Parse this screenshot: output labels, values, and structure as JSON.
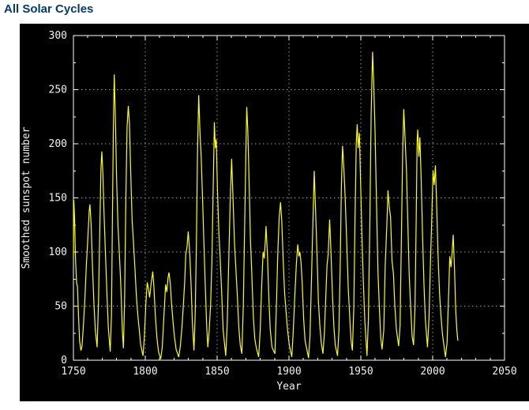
{
  "header": {
    "title": "All Solar Cycles"
  },
  "chart_data": {
    "type": "line",
    "title": "All Solar Cycles",
    "xlabel": "Year",
    "ylabel": "Smoothed sunspot number",
    "xlim": [
      1750,
      2050
    ],
    "ylim": [
      0,
      300
    ],
    "x_major_ticks": [
      1750,
      1800,
      1850,
      1900,
      1950,
      2000,
      2050
    ],
    "x_minor_step": 10,
    "y_major_ticks": [
      0,
      50,
      100,
      150,
      200,
      250,
      300
    ],
    "y_minor_step": 25,
    "grid": "dotted",
    "legend": "none",
    "colors": {
      "line": "#ffff00",
      "plot_background": "#000000",
      "page_background": "#ffffff",
      "frame": "#ffffff",
      "grid": "#9a9a9a",
      "tick_text": "#f2f2f2",
      "title_text": "#003b76"
    },
    "series": [
      {
        "name": "Smoothed sunspot number",
        "points": [
          [
            1750.0,
            95
          ],
          [
            1750.3,
            148
          ],
          [
            1750.8,
            130
          ],
          [
            1751.5,
            92
          ],
          [
            1752.2,
            72
          ],
          [
            1752.8,
            68
          ],
          [
            1753.5,
            42
          ],
          [
            1754.3,
            18
          ],
          [
            1755.2,
            9
          ],
          [
            1756.0,
            13
          ],
          [
            1757.0,
            33
          ],
          [
            1758.0,
            58
          ],
          [
            1759.0,
            88
          ],
          [
            1760.0,
            112
          ],
          [
            1761.0,
            138
          ],
          [
            1761.5,
            144
          ],
          [
            1762.3,
            126
          ],
          [
            1763.2,
            90
          ],
          [
            1764.2,
            55
          ],
          [
            1765.2,
            28
          ],
          [
            1766.5,
            12
          ],
          [
            1767.5,
            55
          ],
          [
            1768.4,
            125
          ],
          [
            1769.2,
            178
          ],
          [
            1769.8,
            193
          ],
          [
            1770.5,
            172
          ],
          [
            1771.3,
            135
          ],
          [
            1772.3,
            98
          ],
          [
            1773.3,
            62
          ],
          [
            1774.3,
            30
          ],
          [
            1775.6,
            8
          ],
          [
            1776.5,
            42
          ],
          [
            1777.2,
            140
          ],
          [
            1777.8,
            215
          ],
          [
            1778.4,
            264
          ],
          [
            1779.2,
            225
          ],
          [
            1780.0,
            170
          ],
          [
            1781.0,
            125
          ],
          [
            1782.0,
            98
          ],
          [
            1783.0,
            68
          ],
          [
            1784.0,
            28
          ],
          [
            1784.8,
            11
          ],
          [
            1785.6,
            55
          ],
          [
            1786.5,
            148
          ],
          [
            1787.3,
            215
          ],
          [
            1788.2,
            235
          ],
          [
            1789.0,
            218
          ],
          [
            1789.8,
            178
          ],
          [
            1790.8,
            130
          ],
          [
            1791.8,
            108
          ],
          [
            1792.8,
            85
          ],
          [
            1793.8,
            60
          ],
          [
            1794.8,
            42
          ],
          [
            1795.8,
            28
          ],
          [
            1796.8,
            14
          ],
          [
            1798.4,
            4
          ],
          [
            1799.4,
            22
          ],
          [
            1800.4,
            52
          ],
          [
            1801.4,
            72
          ],
          [
            1802.2,
            66
          ],
          [
            1803.0,
            58
          ],
          [
            1804.0,
            70
          ],
          [
            1805.2,
            82
          ],
          [
            1806.0,
            68
          ],
          [
            1807.0,
            42
          ],
          [
            1808.0,
            22
          ],
          [
            1809.2,
            8
          ],
          [
            1810.7,
            1
          ],
          [
            1811.8,
            12
          ],
          [
            1813.0,
            42
          ],
          [
            1814.2,
            70
          ],
          [
            1815.0,
            63
          ],
          [
            1815.8,
            76
          ],
          [
            1816.5,
            81
          ],
          [
            1817.4,
            71
          ],
          [
            1818.3,
            52
          ],
          [
            1819.3,
            36
          ],
          [
            1820.3,
            22
          ],
          [
            1821.5,
            10
          ],
          [
            1823.3,
            3
          ],
          [
            1824.4,
            13
          ],
          [
            1825.4,
            28
          ],
          [
            1826.4,
            48
          ],
          [
            1827.4,
            72
          ],
          [
            1828.2,
            98
          ],
          [
            1829.0,
            104
          ],
          [
            1829.9,
            119
          ],
          [
            1830.8,
            102
          ],
          [
            1831.8,
            72
          ],
          [
            1832.8,
            34
          ],
          [
            1833.9,
            9
          ],
          [
            1834.8,
            45
          ],
          [
            1835.6,
            110
          ],
          [
            1836.4,
            195
          ],
          [
            1837.2,
            245
          ],
          [
            1838.0,
            212
          ],
          [
            1838.9,
            188
          ],
          [
            1839.9,
            148
          ],
          [
            1840.9,
            105
          ],
          [
            1841.9,
            62
          ],
          [
            1842.8,
            30
          ],
          [
            1843.5,
            12
          ],
          [
            1844.5,
            28
          ],
          [
            1845.5,
            52
          ],
          [
            1846.4,
            92
          ],
          [
            1847.3,
            162
          ],
          [
            1848.1,
            220
          ],
          [
            1848.8,
            196
          ],
          [
            1849.4,
            204
          ],
          [
            1850.2,
            158
          ],
          [
            1851.2,
            118
          ],
          [
            1852.2,
            92
          ],
          [
            1853.2,
            62
          ],
          [
            1854.2,
            28
          ],
          [
            1856.0,
            4
          ],
          [
            1857.0,
            32
          ],
          [
            1858.0,
            88
          ],
          [
            1859.1,
            148
          ],
          [
            1860.1,
            186
          ],
          [
            1861.1,
            148
          ],
          [
            1862.1,
            108
          ],
          [
            1863.1,
            84
          ],
          [
            1864.1,
            58
          ],
          [
            1865.1,
            30
          ],
          [
            1866.1,
            14
          ],
          [
            1867.2,
            6
          ],
          [
            1868.2,
            48
          ],
          [
            1869.0,
            112
          ],
          [
            1869.9,
            182
          ],
          [
            1870.6,
            234
          ],
          [
            1871.4,
            212
          ],
          [
            1872.2,
            168
          ],
          [
            1873.2,
            112
          ],
          [
            1874.2,
            78
          ],
          [
            1875.2,
            40
          ],
          [
            1876.2,
            20
          ],
          [
            1877.2,
            12
          ],
          [
            1878.9,
            3
          ],
          [
            1880.0,
            28
          ],
          [
            1881.0,
            68
          ],
          [
            1882.0,
            100
          ],
          [
            1882.8,
            94
          ],
          [
            1883.6,
            112
          ],
          [
            1884.0,
            124
          ],
          [
            1885.0,
            98
          ],
          [
            1886.0,
            58
          ],
          [
            1887.0,
            28
          ],
          [
            1888.2,
            12
          ],
          [
            1890.2,
            6
          ],
          [
            1891.2,
            48
          ],
          [
            1892.2,
            98
          ],
          [
            1893.2,
            132
          ],
          [
            1894.1,
            146
          ],
          [
            1895.0,
            128
          ],
          [
            1896.0,
            92
          ],
          [
            1897.0,
            62
          ],
          [
            1898.0,
            44
          ],
          [
            1899.0,
            28
          ],
          [
            1900.2,
            14
          ],
          [
            1902.0,
            3
          ],
          [
            1903.0,
            28
          ],
          [
            1904.0,
            58
          ],
          [
            1905.1,
            88
          ],
          [
            1906.1,
            107
          ],
          [
            1906.9,
            96
          ],
          [
            1907.6,
            100
          ],
          [
            1908.4,
            90
          ],
          [
            1909.2,
            72
          ],
          [
            1910.2,
            38
          ],
          [
            1911.2,
            18
          ],
          [
            1913.6,
            2
          ],
          [
            1914.6,
            22
          ],
          [
            1915.6,
            72
          ],
          [
            1916.6,
            124
          ],
          [
            1917.6,
            175
          ],
          [
            1918.5,
            138
          ],
          [
            1919.5,
            98
          ],
          [
            1920.5,
            54
          ],
          [
            1921.5,
            32
          ],
          [
            1922.5,
            16
          ],
          [
            1923.6,
            6
          ],
          [
            1924.6,
            24
          ],
          [
            1925.6,
            58
          ],
          [
            1926.5,
            88
          ],
          [
            1927.3,
            98
          ],
          [
            1928.3,
            130
          ],
          [
            1929.2,
            102
          ],
          [
            1930.2,
            62
          ],
          [
            1931.2,
            32
          ],
          [
            1932.2,
            14
          ],
          [
            1933.8,
            4
          ],
          [
            1934.8,
            28
          ],
          [
            1935.7,
            92
          ],
          [
            1936.5,
            162
          ],
          [
            1937.3,
            198
          ],
          [
            1938.2,
            178
          ],
          [
            1939.2,
            148
          ],
          [
            1940.2,
            108
          ],
          [
            1941.2,
            68
          ],
          [
            1942.2,
            42
          ],
          [
            1943.2,
            18
          ],
          [
            1944.1,
            9
          ],
          [
            1945.1,
            48
          ],
          [
            1946.0,
            132
          ],
          [
            1946.8,
            200
          ],
          [
            1947.5,
            218
          ],
          [
            1948.2,
            196
          ],
          [
            1949.0,
            210
          ],
          [
            1949.9,
            162
          ],
          [
            1950.8,
            112
          ],
          [
            1951.8,
            70
          ],
          [
            1952.8,
            36
          ],
          [
            1954.3,
            4
          ],
          [
            1955.3,
            38
          ],
          [
            1956.3,
            132
          ],
          [
            1957.2,
            228
          ],
          [
            1958.2,
            285
          ],
          [
            1959.0,
            255
          ],
          [
            1959.9,
            212
          ],
          [
            1960.9,
            148
          ],
          [
            1961.9,
            82
          ],
          [
            1962.9,
            48
          ],
          [
            1963.9,
            20
          ],
          [
            1964.8,
            10
          ],
          [
            1966.0,
            28
          ],
          [
            1967.0,
            88
          ],
          [
            1968.0,
            122
          ],
          [
            1968.9,
            157
          ],
          [
            1969.8,
            142
          ],
          [
            1970.7,
            132
          ],
          [
            1971.7,
            92
          ],
          [
            1972.7,
            80
          ],
          [
            1973.7,
            50
          ],
          [
            1974.8,
            28
          ],
          [
            1976.3,
            13
          ],
          [
            1977.3,
            32
          ],
          [
            1978.2,
            108
          ],
          [
            1979.1,
            192
          ],
          [
            1979.9,
            232
          ],
          [
            1980.8,
            204
          ],
          [
            1981.7,
            178
          ],
          [
            1982.7,
            128
          ],
          [
            1983.7,
            78
          ],
          [
            1984.7,
            48
          ],
          [
            1985.7,
            22
          ],
          [
            1986.7,
            14
          ],
          [
            1987.7,
            48
          ],
          [
            1988.5,
            128
          ],
          [
            1989.2,
            202
          ],
          [
            1989.6,
            213
          ],
          [
            1990.4,
            188
          ],
          [
            1991.1,
            206
          ],
          [
            1992.0,
            168
          ],
          [
            1992.9,
            118
          ],
          [
            1993.9,
            72
          ],
          [
            1994.9,
            38
          ],
          [
            1996.4,
            12
          ],
          [
            1997.4,
            38
          ],
          [
            1998.4,
            88
          ],
          [
            1999.4,
            132
          ],
          [
            2000.3,
            175
          ],
          [
            2001.1,
            162
          ],
          [
            2001.9,
            180
          ],
          [
            2002.8,
            142
          ],
          [
            2003.8,
            95
          ],
          [
            2004.8,
            62
          ],
          [
            2005.8,
            40
          ],
          [
            2006.8,
            24
          ],
          [
            2008.9,
            3
          ],
          [
            2010.0,
            16
          ],
          [
            2011.0,
            56
          ],
          [
            2011.9,
            96
          ],
          [
            2012.8,
            86
          ],
          [
            2013.6,
            102
          ],
          [
            2014.3,
            116
          ],
          [
            2015.2,
            84
          ],
          [
            2016.0,
            48
          ],
          [
            2016.8,
            28
          ],
          [
            2017.5,
            18
          ]
        ]
      }
    ]
  }
}
